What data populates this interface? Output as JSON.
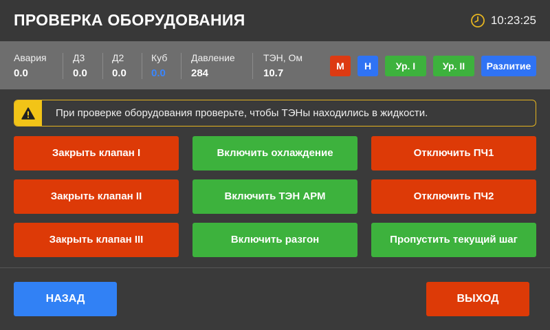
{
  "header": {
    "title": "ПРОВЕРКА ОБОРУДОВАНИЯ",
    "time": "10:23:25",
    "clock_icon": "clock-icon",
    "clock_color": "#e6b520"
  },
  "status": {
    "items": [
      {
        "label": "Авария",
        "value": "0.0"
      },
      {
        "label": "Д3",
        "value": "0.0"
      },
      {
        "label": "Д2",
        "value": "0.0"
      },
      {
        "label": "Куб",
        "value": "0.0",
        "color": "#3a86ff"
      },
      {
        "label": "Давление",
        "value": "284"
      },
      {
        "label": "ТЭН, Ом",
        "value": "10.7"
      }
    ],
    "indicators": [
      {
        "label": "М",
        "color": "#dd3a12"
      },
      {
        "label": "Н",
        "color": "#2f73f4"
      },
      {
        "label": "Ур. I",
        "color": "#3db23d"
      },
      {
        "label": "Ур. II",
        "color": "#3db23d"
      },
      {
        "label": "Разлитие",
        "color": "#2f73f4"
      }
    ]
  },
  "notice": {
    "icon": "warning-icon",
    "text": "При проверке оборудования проверьте, чтобы ТЭНы находились в жидкости."
  },
  "actions": {
    "close_valve_1": "Закрыть клапан I",
    "close_valve_2": "Закрыть клапан II",
    "close_valve_3": "Закрыть клапан III",
    "enable_cooling": "Включить охлаждение",
    "enable_ten_arm": "Включить ТЭН АРМ",
    "enable_acceleration": "Включить разгон",
    "disable_pch1": "Отключить ПЧ1",
    "disable_pch2": "Отключить ПЧ2",
    "skip_step": "Пропустить текущий шаг"
  },
  "footer": {
    "back": "НАЗАД",
    "exit": "ВЫХОД"
  },
  "colors": {
    "red": "#dd3a07",
    "green": "#3db23d",
    "blue": "#3181f5",
    "warning": "#f2c417"
  }
}
